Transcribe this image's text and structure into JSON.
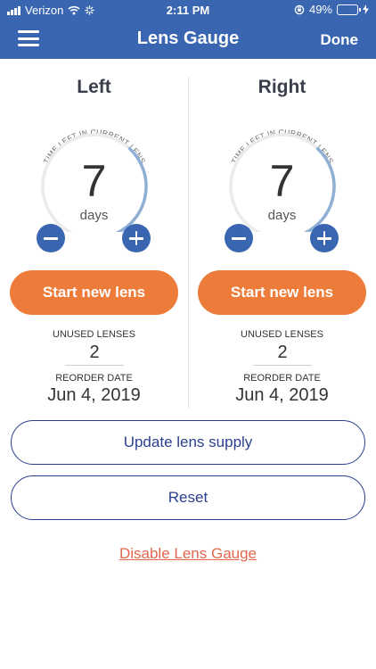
{
  "status_bar": {
    "carrier": "Verizon",
    "time": "2:11 PM",
    "battery": "49%",
    "battery_level": 0.49
  },
  "header": {
    "title": "Lens Gauge",
    "done_label": "Done"
  },
  "gauge_caption": "TIME LEFT IN CURRENT LENS",
  "left": {
    "title": "Left",
    "days_value": "7",
    "days_unit": "days",
    "progress": 0.33,
    "start_label": "Start new lens",
    "unused_label": "UNUSED LENSES",
    "unused_value": "2",
    "reorder_label": "REORDER DATE",
    "reorder_value": "Jun 4, 2019"
  },
  "right": {
    "title": "Right",
    "days_value": "7",
    "days_unit": "days",
    "progress": 0.33,
    "start_label": "Start new lens",
    "unused_label": "UNUSED LENSES",
    "unused_value": "2",
    "reorder_label": "REORDER DATE",
    "reorder_value": "Jun 4, 2019"
  },
  "actions": {
    "update_supply_label": "Update lens supply",
    "reset_label": "Reset",
    "disable_label": "Disable Lens Gauge"
  },
  "colors": {
    "header_bg": "#3a66b1",
    "accent_orange": "#ed7c3a",
    "navy": "#2a3f8f",
    "link_red": "#e2674e",
    "gauge_track": "#ebebeb",
    "gauge_fill": "#8fb0d4"
  }
}
